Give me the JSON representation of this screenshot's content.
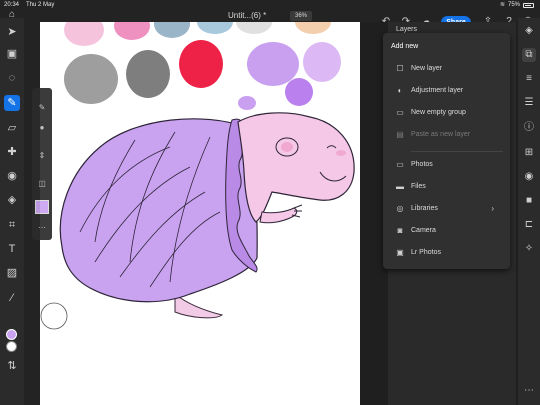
{
  "status": {
    "time": "20:34",
    "date": "Thu 2 May",
    "battery": "75%"
  },
  "document": {
    "title": "Untit...(6) *",
    "zoom": "36%"
  },
  "toolbar": {
    "share_label": "Share"
  },
  "layers": {
    "title": "Layers"
  },
  "add_menu": {
    "title": "Add new",
    "items": [
      {
        "label": "New layer",
        "icon": "square-icon",
        "disabled": false
      },
      {
        "label": "Adjustment layer",
        "icon": "half-circle-icon",
        "disabled": false
      },
      {
        "label": "New empty group",
        "icon": "folder-icon",
        "disabled": false
      },
      {
        "label": "Paste as new layer",
        "icon": "clipboard-icon",
        "disabled": true
      },
      {
        "label": "Photos",
        "icon": "photos-icon",
        "disabled": false
      },
      {
        "label": "Files",
        "icon": "folder-icon",
        "disabled": false
      },
      {
        "label": "Libraries",
        "icon": "libraries-icon",
        "disabled": false,
        "submenu": true
      },
      {
        "label": "Camera",
        "icon": "camera-icon",
        "disabled": false
      },
      {
        "label": "Lr Photos",
        "icon": "lightroom-icon",
        "disabled": false
      }
    ]
  },
  "colors": {
    "accent": "#1473e6",
    "foreground": "#c9a3f0",
    "background": "#ffffff"
  }
}
